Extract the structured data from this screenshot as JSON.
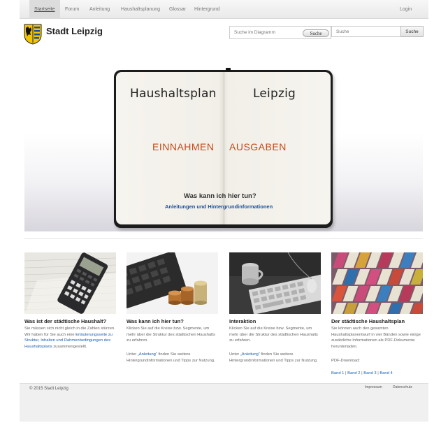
{
  "nav": {
    "items": [
      "Startseite",
      "Forum",
      "Anleitung",
      "Haushaltsplanung",
      "Glossar",
      "Hintergrund"
    ],
    "login": "Login"
  },
  "header": {
    "site_title": "Stadt Leipzig",
    "diagram_search": {
      "placeholder": "Suche im Diagramm",
      "button": "Suche"
    },
    "site_search": {
      "placeholder": "Suche",
      "button": "Suche"
    }
  },
  "hero": {
    "title_left": "Haushaltsplan",
    "title_right": "Leipzig",
    "income_link": "EINNAHMEN",
    "expense_link": "AUSGABEN",
    "question": "Was kann ich hier tun?",
    "help_link": "Anleitungen und Hintergrundinformationen"
  },
  "cards": [
    {
      "title": "Was ist der städtische Haushalt?",
      "text_before": "Sie müssen sich nicht gleich in die Zahlen stürzen. Wir haben für Sie auch eine",
      "link": "Erläuterungsseite zu Struktur, Inhalten und Rahmenbedingungen des Haushaltsplans",
      "text_after": "zusammengestellt."
    },
    {
      "title": "Was kann ich hier tun?",
      "text": "Klicken Sie auf die Kreise bzw. Segmente, um mehr über die Struktur des städtischen Haushalts zu erfahren.",
      "text2_before": "Unter ",
      "text2_link": "„Anleitung“",
      "text2_after": " finden Sie weitere Hintergrundinformationen und Tipps zur Nutzung."
    },
    {
      "title": "Interaktion",
      "text": "Klicken Sie auf die Kreise bzw. Segmente, um mehr über die Struktur des städtischen Haushalts zu erfahren.",
      "text2_before": "Unter ",
      "text2_link": "„Anleitung“",
      "text2_after": " finden Sie weitere Hintergrundinformationen und Tipps zur Nutzung."
    },
    {
      "title": "Der städtische Haushaltsplan",
      "text": "Sie können auch den gesamten Haushaltsplanentwurf in vier Bänden sowie einige zusätzliche Informationen als PDF-Dokumente herunterladen.",
      "download_label": "PDF-Download:",
      "bands": [
        "Band 1",
        "Band 2",
        "Band 3",
        "Band 4"
      ]
    }
  ],
  "footer": {
    "copyright": "© 2015 Stadt Leipzig",
    "links": [
      "Impressum",
      "Datenschutz"
    ]
  },
  "colors": {
    "link": "#1b5fae",
    "hero_accent": "#c24a1c",
    "notebook_cover": "#1c1c1c"
  }
}
